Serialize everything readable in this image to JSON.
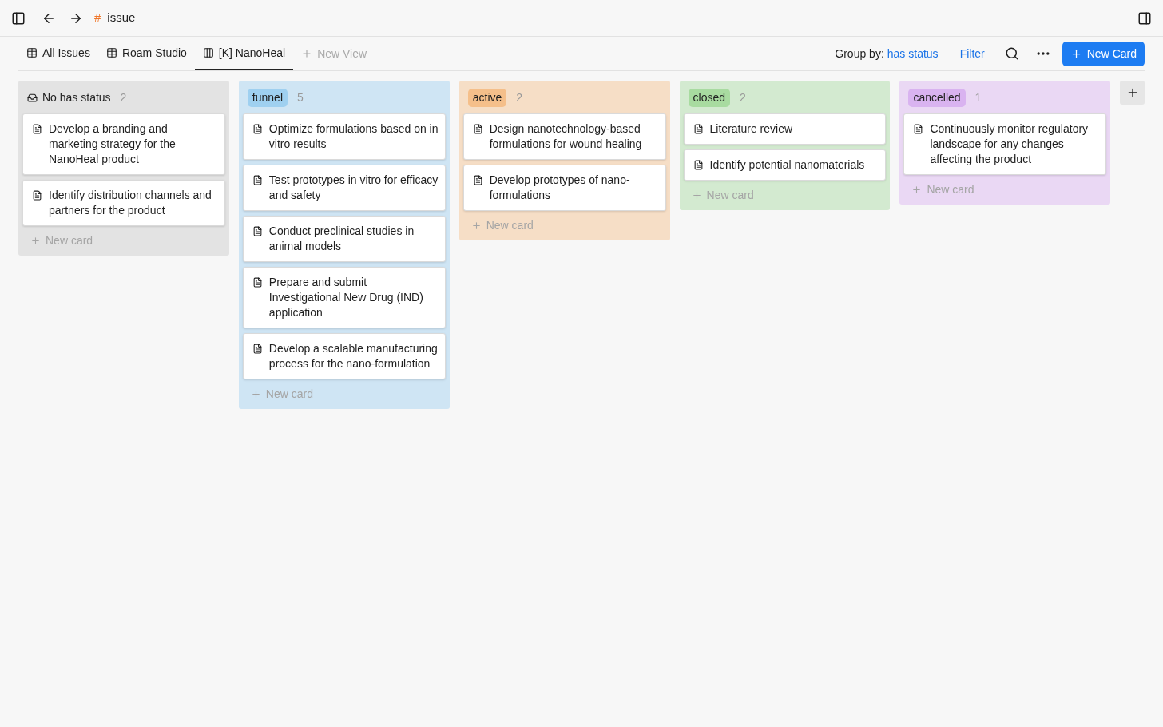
{
  "title_icon": "#",
  "title": "issue",
  "views": [
    {
      "label": "All Issues",
      "kind": "table",
      "selected": false
    },
    {
      "label": "Roam Studio",
      "kind": "table",
      "selected": false
    },
    {
      "label": "[K] NanoHeal",
      "kind": "board",
      "selected": true
    }
  ],
  "new_view": "New View",
  "group_by": {
    "label": "Group by:",
    "value": "has status"
  },
  "filter": "Filter",
  "new_card_button": "New Card",
  "columns": [
    {
      "kind": "none",
      "label": "No has status",
      "count": "2",
      "color": "#e3e3e3",
      "cards": [
        "Develop a branding and marketing strategy for the NanoHeal product",
        "Identify distribution channels and partners for the product"
      ],
      "new_card": "New card"
    },
    {
      "kind": "tag",
      "label": "funnel",
      "count": "5",
      "color": "#9fd0f0",
      "cards": [
        "Optimize formulations based on in vitro results",
        "Test prototypes in vitro for efficacy and safety",
        "Conduct preclinical studies in animal models",
        "Prepare and submit Investigational New Drug (IND) application",
        "Develop a scalable manufacturing process for the nano-formulation"
      ],
      "new_card": "New card"
    },
    {
      "kind": "tag",
      "label": "active",
      "count": "2",
      "color": "#f5bf8a",
      "cards": [
        "Design nanotechnology-based formulations for wound healing",
        "Develop prototypes of nano-formulations"
      ],
      "new_card": "New card"
    },
    {
      "kind": "tag",
      "label": "closed",
      "count": "2",
      "color": "#a8dba0",
      "cards": [
        "Literature review",
        "Identify potential nanomaterials"
      ],
      "new_card": "New card"
    },
    {
      "kind": "tag",
      "label": "cancelled",
      "count": "1",
      "color": "#d9b3f0",
      "cards": [
        "Continuously monitor regulatory landscape for any changes affecting the product"
      ],
      "new_card": "New card"
    }
  ]
}
